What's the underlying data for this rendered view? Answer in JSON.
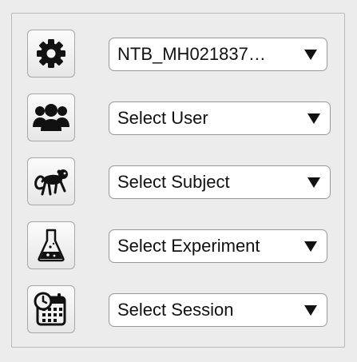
{
  "rows": [
    {
      "icon": "gear-icon",
      "value": "NTB_MH021837…"
    },
    {
      "icon": "users-icon",
      "value": "Select User"
    },
    {
      "icon": "monkey-icon",
      "value": "Select Subject"
    },
    {
      "icon": "flask-icon",
      "value": "Select Experiment"
    },
    {
      "icon": "calendar-clock-icon",
      "value": "Select Session"
    }
  ]
}
